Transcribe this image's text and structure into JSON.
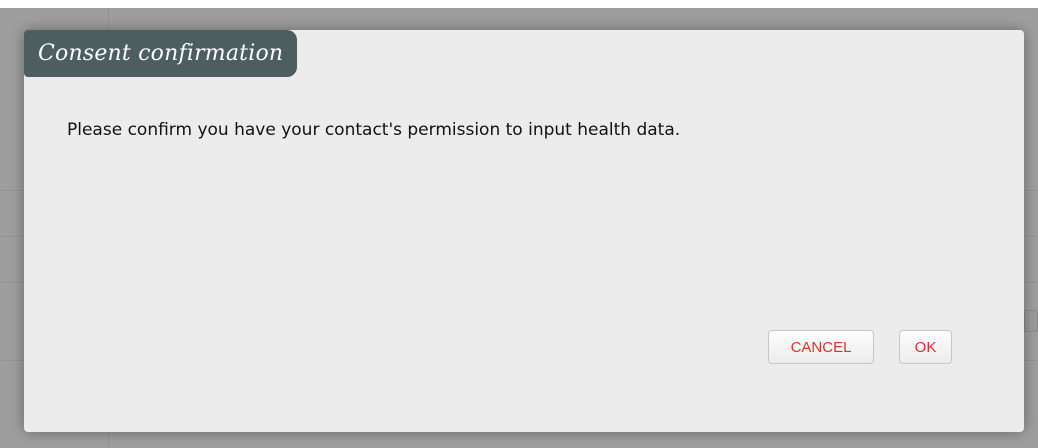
{
  "dialog": {
    "title": "Consent confirmation",
    "message": "Please confirm you have your contact's permission to input health data.",
    "buttons": {
      "cancel_label": "CANCEL",
      "ok_label": "OK"
    }
  },
  "colors": {
    "title_bar": "#4c5e60",
    "dialog_background": "#ececec",
    "button_text": "#e0302b"
  }
}
